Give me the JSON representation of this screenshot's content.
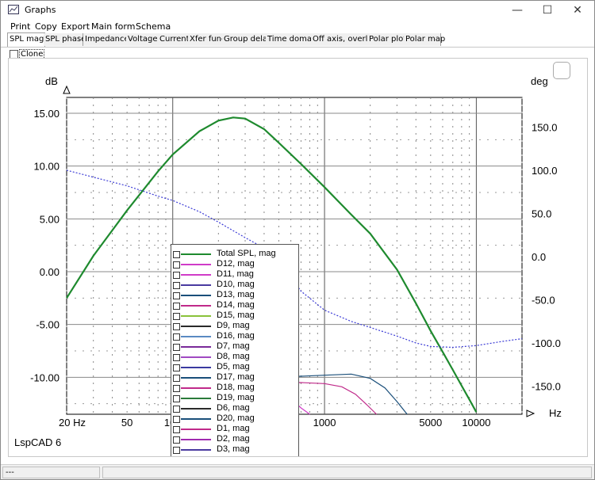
{
  "window": {
    "title": "Graphs"
  },
  "menu": [
    "Print",
    "Copy",
    "Export",
    "Main form",
    "Schema"
  ],
  "tabs": [
    "SPL mag",
    "SPL phase",
    "Impedance",
    "Voltage",
    "Current",
    "Xfer func",
    "Group delay",
    "Time domain",
    "Off axis, overlay",
    "Polar plot",
    "Polar map"
  ],
  "active_tab": "SPL mag",
  "clone_label": "Clone",
  "watermark": "LspCAD 6",
  "status": {
    "left": "---"
  },
  "colors": {
    "total": "#1e8a2e",
    "phase": "#3b3bd6"
  },
  "chart_data": {
    "type": "line",
    "ylabel": "dB",
    "y2label": "deg",
    "xlabel": "Hz",
    "xscale": "log",
    "xlim": [
      20,
      20000
    ],
    "ylim": [
      -13.5,
      16.5
    ],
    "y2lim": [
      -182.5,
      184.3
    ],
    "xticks": [
      "20 Hz",
      "50",
      "100",
      "1000",
      "5000",
      "10000"
    ],
    "yticks": [
      "15.00",
      "10.00",
      "5.00",
      "0.00",
      "-5.00",
      "-10.00"
    ],
    "y2ticks": [
      "150.0",
      "100.0",
      "50.0",
      "0.0",
      "-50.0",
      "-100.0",
      "-150.0"
    ],
    "series": [
      {
        "name": "Total SPL, mag",
        "color": "#1e8a2e",
        "axis": "left",
        "x": [
          20,
          30,
          50,
          80,
          100,
          150,
          200,
          250,
          300,
          400,
          500,
          700,
          1000,
          1500,
          2000,
          3000,
          4000,
          5000,
          6000,
          7000,
          8000,
          9000,
          10000
        ],
        "y": [
          -2.5,
          1.5,
          5.8,
          9.5,
          11.1,
          13.3,
          14.3,
          14.6,
          14.5,
          13.5,
          12.2,
          10.2,
          8.0,
          5.4,
          3.6,
          0.2,
          -3.0,
          -5.6,
          -7.6,
          -9.3,
          -10.8,
          -12.1,
          -13.3
        ]
      },
      {
        "name": "SPL phase",
        "color": "#3b3bd6",
        "axis": "right",
        "dashed": true,
        "x": [
          20,
          30,
          50,
          80,
          100,
          150,
          200,
          300,
          400,
          500,
          700,
          1000,
          1500,
          2000,
          3000,
          4000,
          5000,
          7000,
          10000,
          15000,
          20000
        ],
        "y": [
          100,
          92,
          82,
          70,
          65,
          52,
          40,
          22,
          10,
          -5,
          -40,
          -62,
          -75,
          -82,
          -92,
          -100,
          -104,
          -105,
          -103,
          -98,
          -95
        ]
      },
      {
        "name": "D17, mag",
        "color": "#1a4f7a",
        "axis": "left",
        "x": [
          300,
          500,
          700,
          1000,
          1500,
          2000,
          2500,
          3000,
          3500
        ],
        "y": [
          -10.1,
          -10.0,
          -9.9,
          -9.8,
          -9.7,
          -10.1,
          -11.0,
          -12.3,
          -13.5
        ]
      },
      {
        "name": "D18, mag",
        "color": "#c02a8a",
        "axis": "left",
        "x": [
          300,
          500,
          700,
          1000,
          1300,
          1600,
          1900,
          2200
        ],
        "y": [
          -10.5,
          -10.5,
          -10.5,
          -10.6,
          -10.9,
          -11.6,
          -12.6,
          -13.5
        ]
      },
      {
        "name": "D11, mag",
        "color": "#d03cc8",
        "axis": "left",
        "x": [
          300,
          400,
          500,
          600,
          700,
          800
        ],
        "y": [
          -10.5,
          -10.7,
          -11.2,
          -12.0,
          -12.9,
          -13.5
        ]
      }
    ],
    "legend": [
      "Total SPL, mag",
      "D12, mag",
      "D11, mag",
      "D10, mag",
      "D13, mag",
      "D14, mag",
      "D15, mag",
      "D9, mag",
      "D16, mag",
      "D7, mag",
      "D8, mag",
      "D5, mag",
      "D17, mag",
      "D18, mag",
      "D19, mag",
      "D6, mag",
      "D20, mag",
      "D1, mag",
      "D2, mag",
      "D3, mag"
    ],
    "legend_colors": [
      "#1e8a2e",
      "#d03cc8",
      "#d03cc8",
      "#4a3aa0",
      "#1a4f7a",
      "#c02a8a",
      "#8ac23a",
      "#2a2a2a",
      "#5a8ac2",
      "#7a2a9a",
      "#a04ac2",
      "#3a3aa0",
      "#1a4f7a",
      "#c02a8a",
      "#2a7a3a",
      "#2a2a2a",
      "#1a4f7a",
      "#c02a8a",
      "#a02ab0",
      "#4a3aa0"
    ],
    "grid": true,
    "legend_position": "center-bottom"
  }
}
